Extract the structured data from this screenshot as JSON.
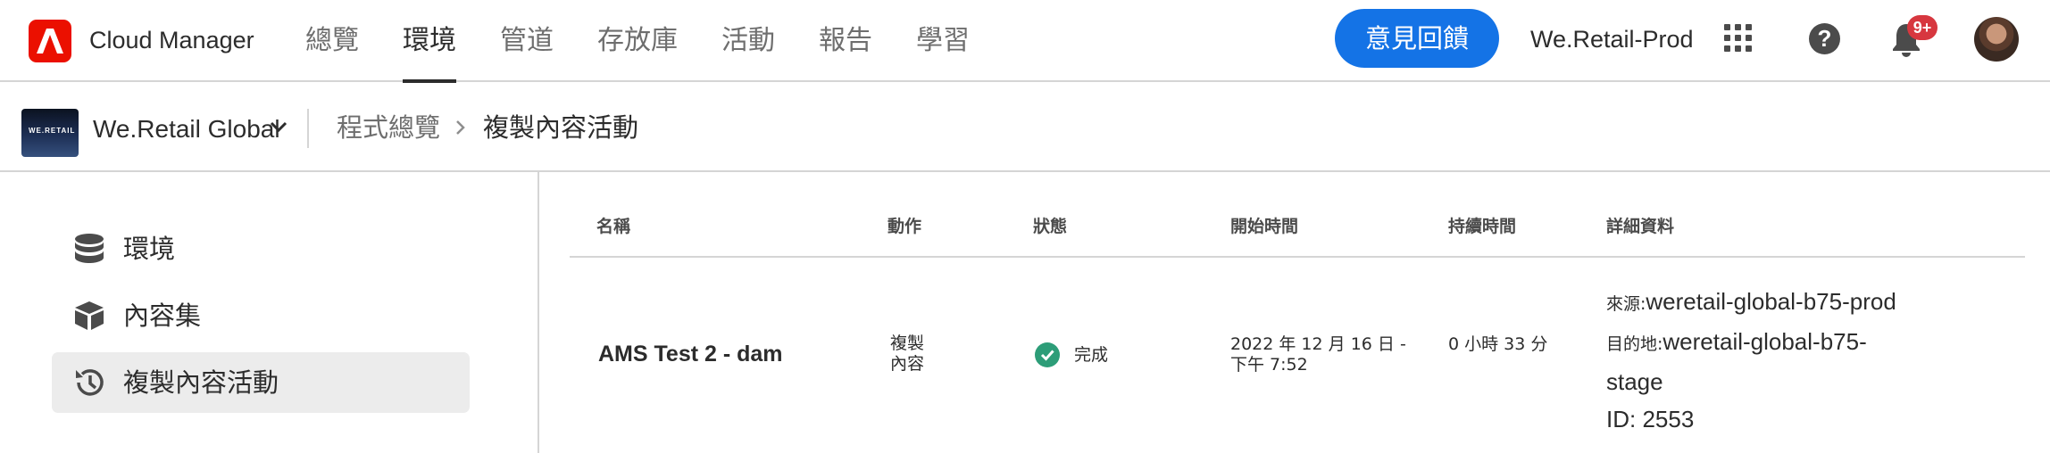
{
  "app": {
    "title": "Cloud Manager",
    "brand_color": "#eb1000",
    "accent_color": "#1473e6"
  },
  "nav": {
    "items": [
      {
        "label": "總覽",
        "active": false
      },
      {
        "label": "環境",
        "active": true
      },
      {
        "label": "管道",
        "active": false
      },
      {
        "label": "存放庫",
        "active": false
      },
      {
        "label": "活動",
        "active": false
      },
      {
        "label": "報告",
        "active": false
      },
      {
        "label": "學習",
        "active": false
      }
    ]
  },
  "header": {
    "feedback_label": "意見回饋",
    "org_name": "We.Retail-Prod",
    "notification_count": "9+",
    "icons": [
      "apps-grid-icon",
      "help-icon",
      "bell-icon",
      "avatar"
    ]
  },
  "subbar": {
    "program_thumb_text": "WE.RETAIL",
    "program_name": "We.Retail Global",
    "breadcrumb": [
      "程式總覽",
      "複製內容活動"
    ]
  },
  "sidebar": {
    "items": [
      {
        "label": "環境",
        "icon": "database-icon",
        "active": false
      },
      {
        "label": "內容集",
        "icon": "package-icon",
        "active": false
      },
      {
        "label": "複製內容活動",
        "icon": "history-icon",
        "active": true
      }
    ]
  },
  "table": {
    "headers": [
      "名稱",
      "動作",
      "狀態",
      "開始時間",
      "持續時間",
      "詳細資料"
    ],
    "rows": [
      {
        "name": "AMS Test 2 - dam",
        "action": "複製\n內容",
        "status": "完成",
        "status_color": "#2d9d78",
        "start_time": "2022 年 12 月 16 日 -\n下午 7:52",
        "duration": "0 小時 33 分",
        "details": {
          "source_label": "來源:",
          "source": "weretail-global-b75-prod",
          "target_label": "目的地:",
          "target": "weretail-global-b75-",
          "target_cont": "stage",
          "id": "ID: 2553"
        }
      }
    ]
  }
}
